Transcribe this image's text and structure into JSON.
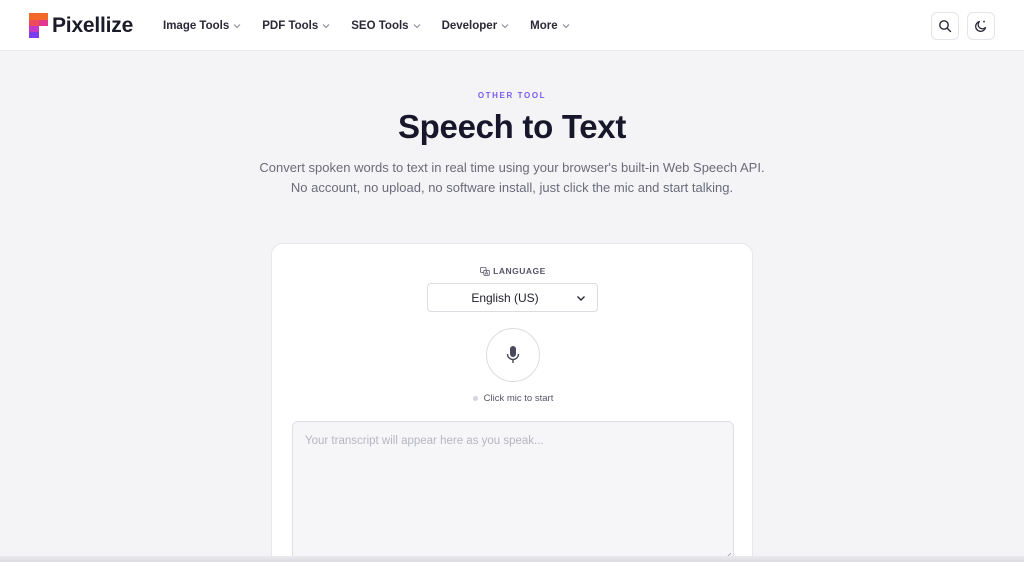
{
  "brand": {
    "name": "Pixellize"
  },
  "nav": {
    "items": [
      {
        "label": "Image Tools"
      },
      {
        "label": "PDF Tools"
      },
      {
        "label": "SEO Tools"
      },
      {
        "label": "Developer"
      },
      {
        "label": "More"
      }
    ]
  },
  "header_actions": {
    "search_icon": "search-icon",
    "theme_icon": "moon-icon"
  },
  "hero": {
    "eyebrow": "OTHER TOOL",
    "title": "Speech to Text",
    "subtitle": "Convert spoken words to text in real time using your browser's built-in Web Speech API. No account, no upload, no software install, just click the mic and start talking."
  },
  "tool": {
    "language_label": "LANGUAGE",
    "language_value": "English (US)",
    "mic_icon": "microphone-icon",
    "status": "Click mic to start",
    "transcript_placeholder": "Your transcript will appear here as you speak..."
  },
  "colors": {
    "accent": "#7b5cf0",
    "background": "#f4f4f6",
    "logo_orange": "#f26a2a",
    "logo_pink": "#e2388f",
    "logo_purple": "#7b3df0"
  }
}
